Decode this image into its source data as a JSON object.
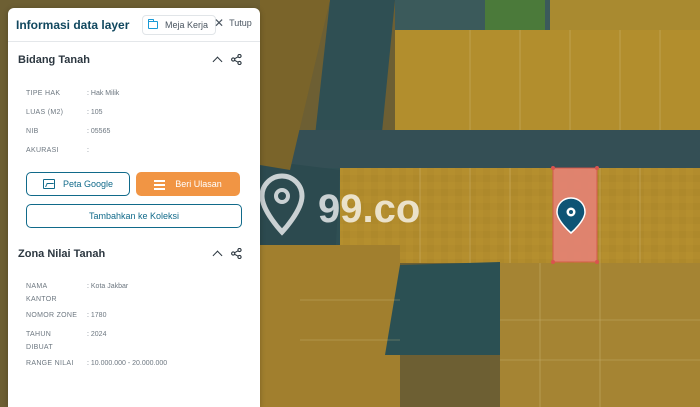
{
  "panel": {
    "title": "Informasi data layer",
    "meja_kerja_label": "Meja Kerja",
    "tutup_label": "Tutup"
  },
  "bidang_tanah": {
    "title": "Bidang Tanah",
    "rows": [
      {
        "key": "TIPE HAK",
        "value": ": Hak Milik"
      },
      {
        "key": "LUAS (M2)",
        "value": ": 105"
      },
      {
        "key": "NIB",
        "value": ": 05565"
      },
      {
        "key": "AKURASI",
        "value": ":"
      }
    ],
    "btn_google": "Peta Google",
    "btn_ulasan": "Beri Ulasan",
    "btn_koleksi": "Tambahkan ke Koleksi"
  },
  "zona_nilai": {
    "title": "Zona Nilai Tanah",
    "rows": [
      {
        "key": "NAMA\nKANTOR",
        "value": ": Kota Jakbar"
      },
      {
        "key": "NOMOR ZONE",
        "value": ": 1780"
      },
      {
        "key": "TAHUN\nDIBUAT",
        "value": ": 2024"
      },
      {
        "key": "RANGE NILAI",
        "value": ": 10.000.000 - 20.000.000"
      }
    ]
  },
  "watermark": "99.co",
  "colors": {
    "brand": "#10475e",
    "accent_orange": "#f19544",
    "parcel_highlight": "#e8827a",
    "marker": "#0e5475"
  },
  "icons": [
    "folder-icon",
    "close-icon",
    "chevron-up-icon",
    "share-icon",
    "map-icon",
    "list-icon",
    "location-pin-icon"
  ]
}
